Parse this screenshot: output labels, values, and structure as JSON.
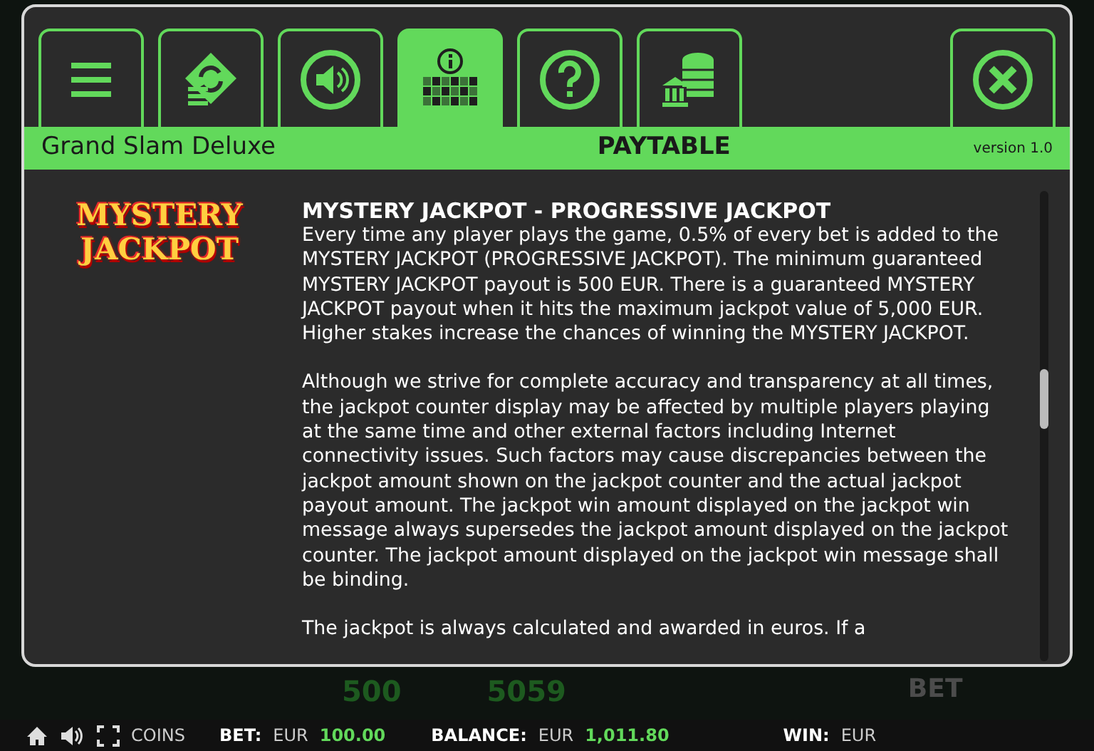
{
  "tabs": [
    {
      "kind": "menu",
      "selected": false
    },
    {
      "kind": "swap",
      "selected": false
    },
    {
      "kind": "sound",
      "selected": false
    },
    {
      "kind": "paytable",
      "selected": true
    },
    {
      "kind": "help",
      "selected": false
    },
    {
      "kind": "coins",
      "selected": false
    }
  ],
  "header": {
    "game_title": "Grand Slam Deluxe",
    "section_title": "PAYTABLE",
    "version": "version 1.0"
  },
  "content": {
    "logo": [
      "MYSTERY",
      "JACKPOT"
    ],
    "heading": "MYSTERY JACKPOT - PROGRESSIVE JACKPOT",
    "paragraphs": [
      "Every time any player plays the game, 0.5% of every bet is added to the MYSTERY JACKPOT (PROGRESSIVE JACKPOT). The minimum guaranteed MYSTERY JACKPOT payout is 500 EUR. There is a guaranteed MYSTERY JACKPOT payout when it hits the maximum jackpot value of 5,000 EUR. Higher stakes increase the chances of winning the MYSTERY JACKPOT.",
      "Although we strive for complete accuracy and transparency at all times, the jackpot counter display may be affected by multiple players playing at the same time and other external factors including Internet connectivity issues. Such factors may cause discrepancies between the jackpot amount shown on the jackpot counter and the actual jackpot payout amount. The jackpot win amount displayed on the jackpot win message always supersedes the jackpot amount displayed on the jackpot counter. The jackpot amount displayed on the jackpot win message shall be binding.",
      "The jackpot is always calculated and awarded in euros. If a"
    ]
  },
  "game_controls": [
    "500",
    "5059",
    "BET"
  ],
  "status_bar": {
    "coins": "COINS",
    "bet_label": "BET:",
    "bet_currency": "EUR",
    "bet_value": "100.00",
    "balance_label": "BALANCE:",
    "balance_currency": "EUR",
    "balance_value": "1,011.80",
    "win_label": "WIN:",
    "win_currency": "EUR"
  }
}
